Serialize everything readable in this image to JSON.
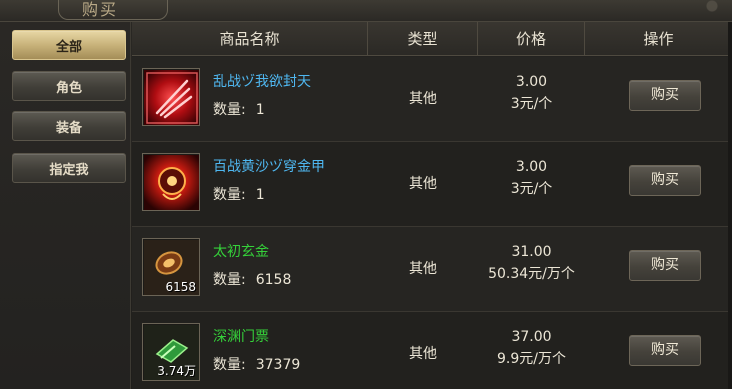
{
  "window": {
    "title": "购买"
  },
  "sidebar": {
    "items": [
      {
        "label": "全部",
        "active": true
      },
      {
        "label": "角色",
        "active": false
      },
      {
        "label": "装备",
        "active": false
      },
      {
        "label": "指定我",
        "active": false
      }
    ]
  },
  "table": {
    "headers": [
      "商品名称",
      "类型",
      "价格",
      "操作"
    ],
    "qty_label": "数量:",
    "rows": [
      {
        "name": "乱战ヅ我欲封天",
        "name_color": "#4fb7f0",
        "quantity": "1",
        "badge": "",
        "type": "其他",
        "price": "3.00",
        "unit_price": "3元/个",
        "action": "购买",
        "icon": "red-claw-skill-icon"
      },
      {
        "name": "百战黄沙ヅ穿金甲",
        "name_color": "#4fb7f0",
        "quantity": "1",
        "badge": "",
        "type": "其他",
        "price": "3.00",
        "unit_price": "3元/个",
        "action": "购买",
        "icon": "fire-armor-icon"
      },
      {
        "name": "太初玄金",
        "name_color": "#35d13a",
        "quantity": "6158",
        "badge": "6158",
        "type": "其他",
        "price": "31.00",
        "unit_price": "50.34元/万个",
        "action": "购买",
        "icon": "gold-ore-icon"
      },
      {
        "name": "深渊门票",
        "name_color": "#35d13a",
        "quantity": "37379",
        "badge": "3.74万",
        "type": "其他",
        "price": "37.00",
        "unit_price": "9.9元/万个",
        "action": "购买",
        "icon": "green-ticket-icon"
      }
    ]
  }
}
